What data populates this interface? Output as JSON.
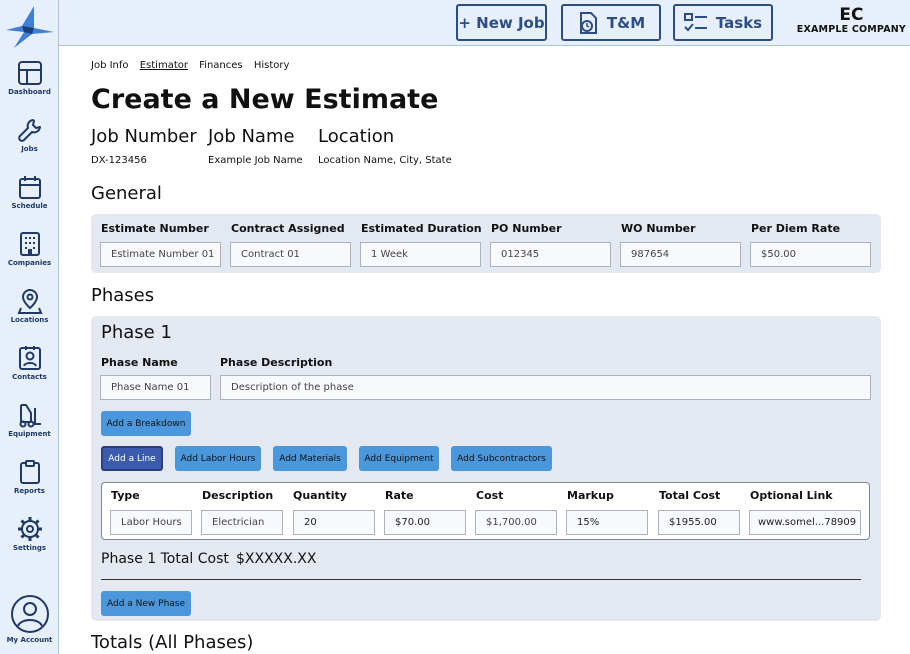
{
  "sidebar": {
    "items": [
      {
        "label": "Dashboard",
        "icon": "dashboard-icon"
      },
      {
        "label": "Jobs",
        "icon": "wrench-icon"
      },
      {
        "label": "Schedule",
        "icon": "calendar-icon"
      },
      {
        "label": "Companies",
        "icon": "building-icon"
      },
      {
        "label": "Locations",
        "icon": "map-pin-icon"
      },
      {
        "label": "Contacts",
        "icon": "contact-icon"
      },
      {
        "label": "Equipment",
        "icon": "forklift-icon"
      },
      {
        "label": "Reports",
        "icon": "clipboard-icon"
      },
      {
        "label": "Settings",
        "icon": "gear-icon"
      },
      {
        "label": "My Account",
        "icon": "user-icon"
      }
    ]
  },
  "topbar": {
    "new_job_label": "+ New Job",
    "tm_label": "T&M",
    "tasks_label": "Tasks",
    "brand_short": "EC",
    "brand_name": "EXAMPLE COMPANY"
  },
  "tabs": [
    {
      "label": "Job Info"
    },
    {
      "label": "Estimator"
    },
    {
      "label": "Finances"
    },
    {
      "label": "History"
    }
  ],
  "page_title": "Create a New Estimate",
  "job": {
    "number_label": "Job Number",
    "name_label": "Job Name",
    "location_label": "Location",
    "number": "DX-123456",
    "name": "Example Job Name",
    "location": "Location Name, City, State"
  },
  "general": {
    "heading": "General",
    "fields": [
      {
        "label": "Estimate Number",
        "placeholder": "Estimate Number 01"
      },
      {
        "label": "Contract Assigned",
        "placeholder": "Contract 01"
      },
      {
        "label": "Estimated Duration",
        "placeholder": "1 Week"
      },
      {
        "label": "PO Number",
        "placeholder": "012345"
      },
      {
        "label": "WO Number",
        "placeholder": "987654"
      },
      {
        "label": "Per Diem Rate",
        "placeholder": "$50.00"
      }
    ]
  },
  "phases": {
    "heading": "Phases",
    "phase_title": "Phase 1",
    "phase_name_label": "Phase Name",
    "phase_name_placeholder": "Phase Name 01",
    "phase_desc_label": "Phase Description",
    "phase_desc_placeholder": "Description of the phase",
    "add_breakdown": "Add a Breakdown",
    "buttons": [
      "Add a Line",
      "Add Labor Hours",
      "Add Materials",
      "Add Equipment",
      "Add Subcontractors"
    ],
    "line_headers": [
      "Type",
      "Description",
      "Quantity",
      "Rate",
      "Cost",
      "Markup",
      "Total Cost",
      "Optional Link"
    ],
    "line_values": [
      "Labor Hours",
      "Electrician",
      "20",
      "$70.00",
      "$1,700.00",
      "15%",
      "$1955.00",
      "www.somel...78909"
    ],
    "total_label": "Phase 1 Total Cost",
    "total_value": "$XXXXX.XX",
    "add_phase": "Add a New Phase"
  },
  "totals_heading": "Totals (All Phases)"
}
